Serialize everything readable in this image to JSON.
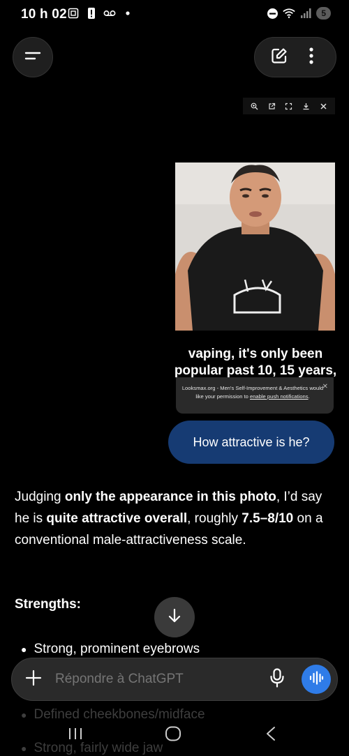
{
  "status_bar": {
    "time": "10 h 02",
    "battery": "5",
    "icons": [
      "screenshot-icon",
      "alert-icon",
      "voicemail-icon",
      "dot-icon",
      "dnd-icon",
      "wifi-icon",
      "signal-icon"
    ]
  },
  "header": {
    "menu_icon": "menu-icon",
    "new_chat_icon": "edit-icon",
    "more_icon": "more-vertical-icon"
  },
  "image_toolbar": {
    "icons": [
      "zoom-icon",
      "open-external-icon",
      "fullscreen-icon",
      "download-icon",
      "close-icon"
    ]
  },
  "attachment": {
    "caption": "vaping, it's only been popular past 10, 15 years,",
    "notification": {
      "text": "Looksmax.org - Men's Self-Improvement & Aesthetics would like your permission to ",
      "link": "enable push notifications",
      "suffix": "."
    }
  },
  "user_message": "How attractive is he?",
  "assistant": {
    "p1_a": "Judging ",
    "p1_b": "only the appearance in this photo",
    "p1_c": ", I’d say he is ",
    "p1_d": "quite attractive overall",
    "p1_e": ", roughly ",
    "p1_f": "7.5–8/10",
    "p1_g": " on a conventional male-attractiveness scale.",
    "strengths_heading": "Strengths:",
    "bullets": [
      "Strong, prominent eyebrows",
      "Defined cheekbones/midface",
      "Strong, fairly wide jaw"
    ]
  },
  "composer": {
    "placeholder": "Répondre à ChatGPT"
  },
  "colors": {
    "user_bubble": "#163b73",
    "voice_button": "#2f7ce8",
    "background": "#000000"
  }
}
